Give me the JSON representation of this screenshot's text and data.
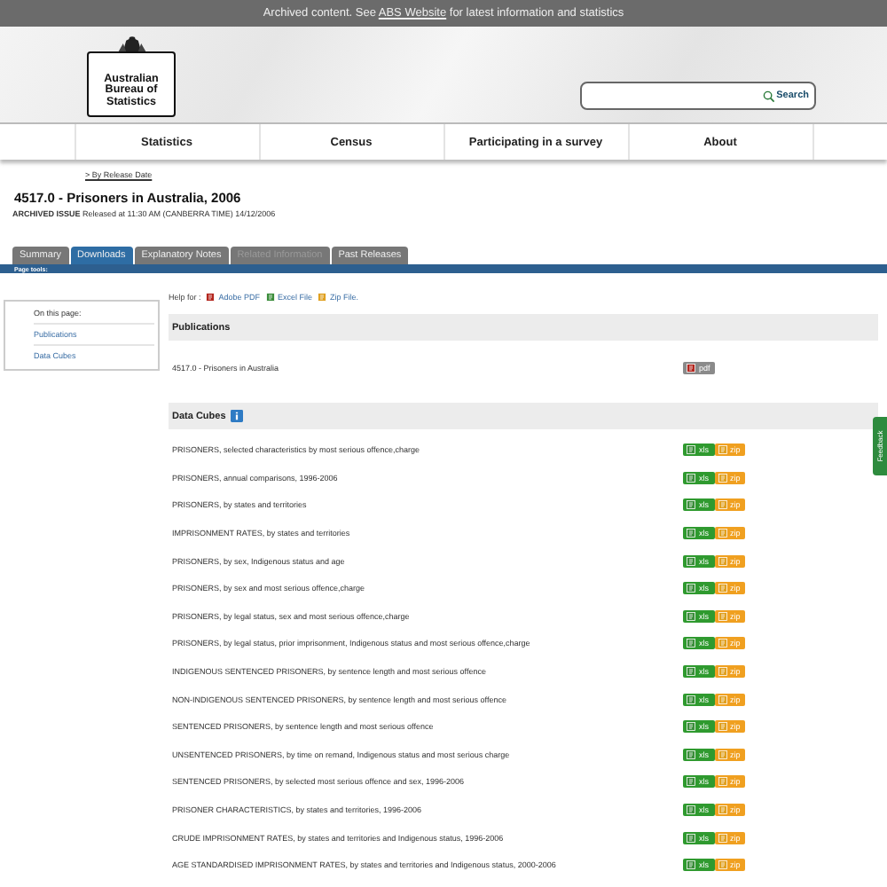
{
  "banner": {
    "before": "Archived content. See ",
    "link": "ABS Website",
    "after": " for latest information and statistics"
  },
  "logo": {
    "lines": [
      "Australian",
      "Bureau of",
      "Statistics"
    ]
  },
  "search": {
    "button": "Search"
  },
  "nav": [
    "Statistics",
    "Census",
    "Participating in a survey",
    "About"
  ],
  "breadcrumb": "> By Release Date",
  "title": "4517.0 - Prisoners in Australia, 2006",
  "issue": {
    "label": "ARCHIVED ISSUE",
    "text": "Released at 11:30 AM (CANBERRA TIME) 14/12/2006"
  },
  "tabs": [
    {
      "label": "Summary",
      "selected": false,
      "disabled": false
    },
    {
      "label": "Downloads",
      "selected": true,
      "disabled": false
    },
    {
      "label": "Explanatory Notes",
      "selected": false,
      "disabled": false
    },
    {
      "label": "Related Information",
      "selected": false,
      "disabled": true
    },
    {
      "label": "Past Releases",
      "selected": false,
      "disabled": false
    }
  ],
  "page_tools": "Page tools:",
  "sidebar": {
    "title": "On this page:",
    "items": [
      "Publications",
      "Data Cubes"
    ]
  },
  "help": {
    "label": "Help for :",
    "links": [
      {
        "kind": "pdf",
        "label": "Adobe PDF"
      },
      {
        "kind": "xls",
        "label": "Excel File"
      },
      {
        "kind": "zip",
        "label": "Zip File."
      }
    ]
  },
  "publications": {
    "heading": "Publications",
    "rows": [
      {
        "title": "4517.0 - Prisoners in Australia",
        "button": "pdf"
      }
    ]
  },
  "data_cubes": {
    "heading": "Data Cubes",
    "rows": [
      {
        "title": "PRISONERS, selected characteristics by most serious offence,charge",
        "xls": "xls",
        "zip": "zip"
      },
      {
        "title": "PRISONERS, annual comparisons, 1996-2006",
        "xls": "xls",
        "zip": "zip"
      },
      {
        "title": "PRISONERS, by states and territories",
        "xls": "xls",
        "zip": "zip"
      },
      {
        "title": "IMPRISONMENT RATES, by states and territories",
        "xls": "xls",
        "zip": "zip"
      },
      {
        "title": "PRISONERS, by sex, Indigenous status and age",
        "xls": "xls",
        "zip": "zip"
      },
      {
        "title": "PRISONERS, by sex and most serious offence,charge",
        "xls": "xls",
        "zip": "zip"
      },
      {
        "title": "PRISONERS, by legal status, sex and most serious offence,charge",
        "xls": "xls",
        "zip": "zip"
      },
      {
        "title": "PRISONERS, by legal status, prior imprisonment, Indigenous status and most serious offence,charge",
        "xls": "xls",
        "zip": "zip"
      },
      {
        "title": "INDIGENOUS SENTENCED PRISONERS, by sentence length and most serious offence",
        "xls": "xls",
        "zip": "zip"
      },
      {
        "title": "NON-INDIGENOUS SENTENCED PRISONERS, by sentence length and most serious offence",
        "xls": "xls",
        "zip": "zip"
      },
      {
        "title": "SENTENCED PRISONERS, by sentence length and most serious offence",
        "xls": "xls",
        "zip": "zip"
      },
      {
        "title": "UNSENTENCED PRISONERS, by time on remand, Indigenous status and most serious charge",
        "xls": "xls",
        "zip": "zip"
      },
      {
        "title": "SENTENCED PRISONERS, by selected most serious offence and sex, 1996-2006",
        "xls": "xls",
        "zip": "zip"
      },
      {
        "title": "PRISONER CHARACTERISTICS, by states and territories, 1996-2006",
        "xls": "xls",
        "zip": "zip"
      },
      {
        "title": "CRUDE IMPRISONMENT RATES, by states and territories and Indigenous status, 1996-2006",
        "xls": "xls",
        "zip": "zip"
      },
      {
        "title": "AGE STANDARDISED IMPRISONMENT RATES, by states and territories and Indigenous status, 2000-2006",
        "xls": "xls",
        "zip": "zip"
      }
    ]
  },
  "feedback": "Feedback"
}
